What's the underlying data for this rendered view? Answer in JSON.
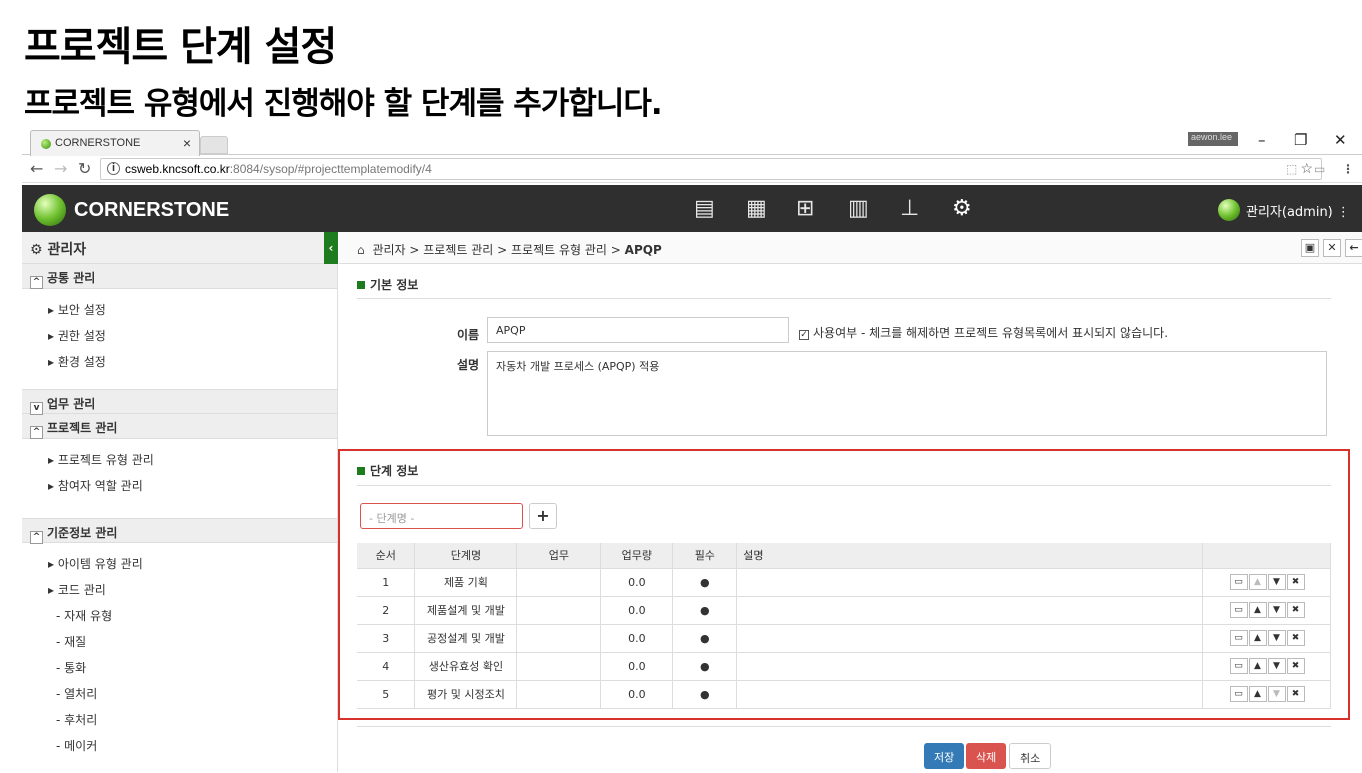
{
  "slide": {
    "title": "프로젝트 단계 설정",
    "subtitle": "프로젝트 유형에서 진행해야 할 단계를 추가합니다."
  },
  "browser": {
    "tab_title": "CORNERSTONE",
    "tab_close": "×",
    "user_chip": "aewon.lee",
    "url_host": "csweb.kncsoft.co.kr",
    "url_path": ":8084/sysop/#projecttemplatemodify/4"
  },
  "app": {
    "brand": "CORNERSTONE",
    "user": "관리자(admin)",
    "accent": "#1e7b1e"
  },
  "sidebar": {
    "title": "관리자",
    "groups": [
      {
        "label": "공통 관리",
        "items": [
          "보안 설정",
          "권한 설정",
          "환경 설정"
        ]
      },
      {
        "label": "업무 관리",
        "items": []
      },
      {
        "label": "프로젝트 관리",
        "items": [
          "프로젝트 유형 관리",
          "참여자 역할 관리"
        ]
      },
      {
        "label": "기준정보 관리",
        "items": [
          "아이템 유형 관리",
          "코드 관리"
        ],
        "subitems": [
          "- 자재 유형",
          "- 재질",
          "- 통화",
          "- 열처리",
          "- 후처리",
          "- 메이커"
        ]
      }
    ]
  },
  "breadcrumb": {
    "items": [
      "관리자",
      "프로젝트 관리",
      "프로젝트 유형 관리"
    ],
    "current": "APQP"
  },
  "basic": {
    "section": "기본 정보",
    "name_label": "이름",
    "name_value": "APQP",
    "use_label": "사용여부 - 체크를 해제하면 프로젝트 유형목록에서 표시되지 않습니다.",
    "desc_label": "설명",
    "desc_value": "자동차 개발 프로세스 (APQP) 적용"
  },
  "stages": {
    "section": "단계 정보",
    "placeholder": "- 단계명 -",
    "add": "+",
    "headers": [
      "순서",
      "단계명",
      "업무",
      "업무량",
      "필수",
      "설명"
    ],
    "rows": [
      {
        "order": "1",
        "name": "제품 기획",
        "task": "",
        "amount": "0.0",
        "required": "●",
        "desc": ""
      },
      {
        "order": "2",
        "name": "제품설계 및 개발",
        "task": "",
        "amount": "0.0",
        "required": "●",
        "desc": ""
      },
      {
        "order": "3",
        "name": "공정설계 및 개발",
        "task": "",
        "amount": "0.0",
        "required": "●",
        "desc": ""
      },
      {
        "order": "4",
        "name": "생산유효성 확인",
        "task": "",
        "amount": "0.0",
        "required": "●",
        "desc": ""
      },
      {
        "order": "5",
        "name": "평가 및 시정조치",
        "task": "",
        "amount": "0.0",
        "required": "●",
        "desc": ""
      }
    ]
  },
  "footer": {
    "save": "저장",
    "delete": "삭제",
    "cancel": "취소"
  }
}
